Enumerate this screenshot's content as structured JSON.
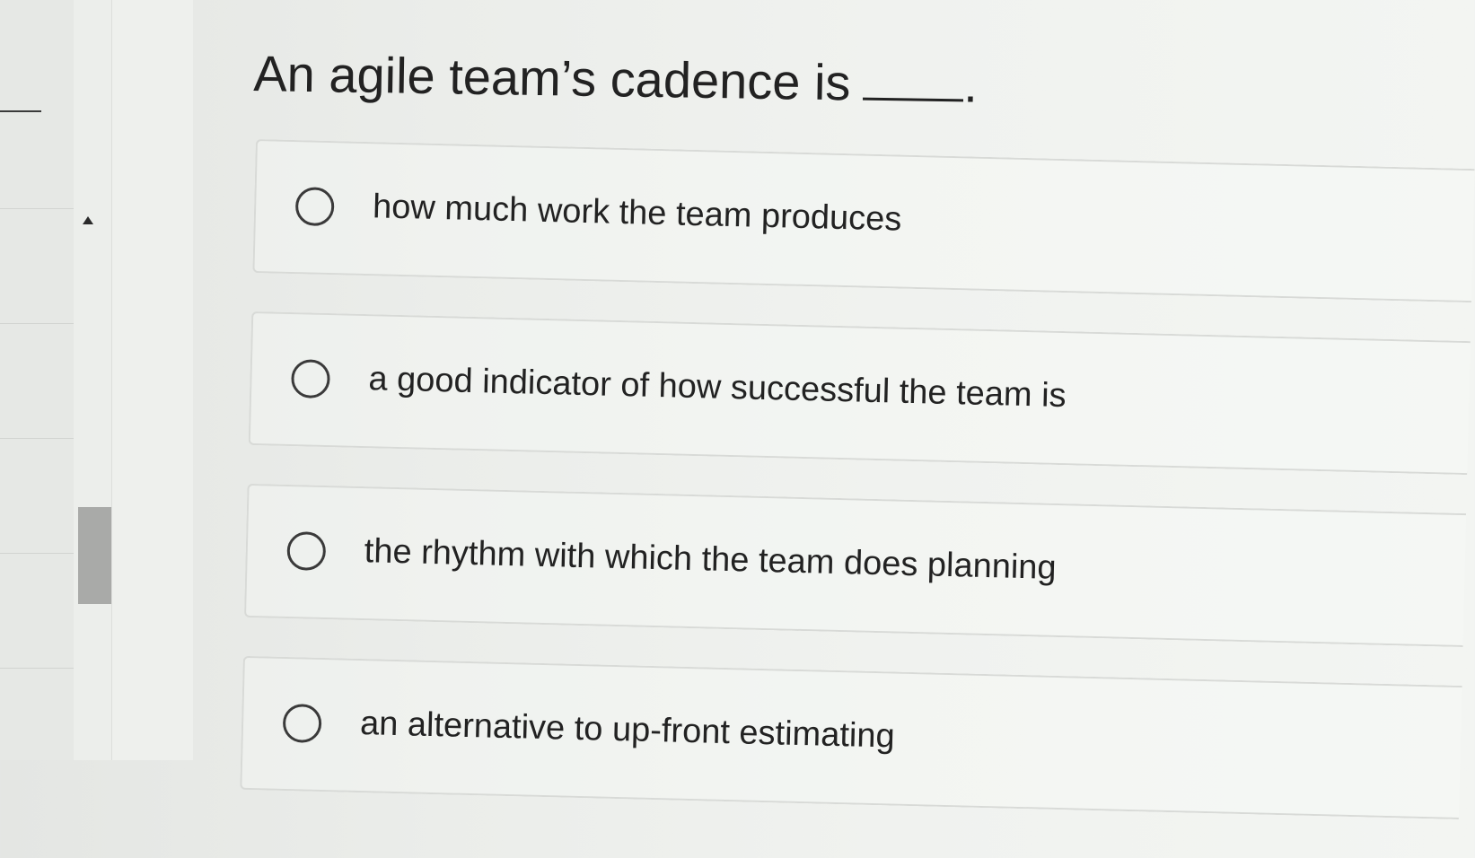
{
  "question": {
    "text": "An agile team’s cadence is",
    "trailing": "."
  },
  "options": [
    {
      "label": "how much work the team produces"
    },
    {
      "label": "a good indicator of how successful the team is"
    },
    {
      "label": "the rhythm with which the team does planning"
    },
    {
      "label": "an alternative to up-front estimating"
    }
  ],
  "colors": {
    "background": "#eef0ed",
    "text": "#222222",
    "radio_border": "#3a3a3a",
    "card_border": "#d8dad7",
    "scroll_thumb": "#a9aaa8"
  },
  "icons": {
    "scroll_up": "caret-up-icon",
    "radio": "radio-circle-icon"
  }
}
